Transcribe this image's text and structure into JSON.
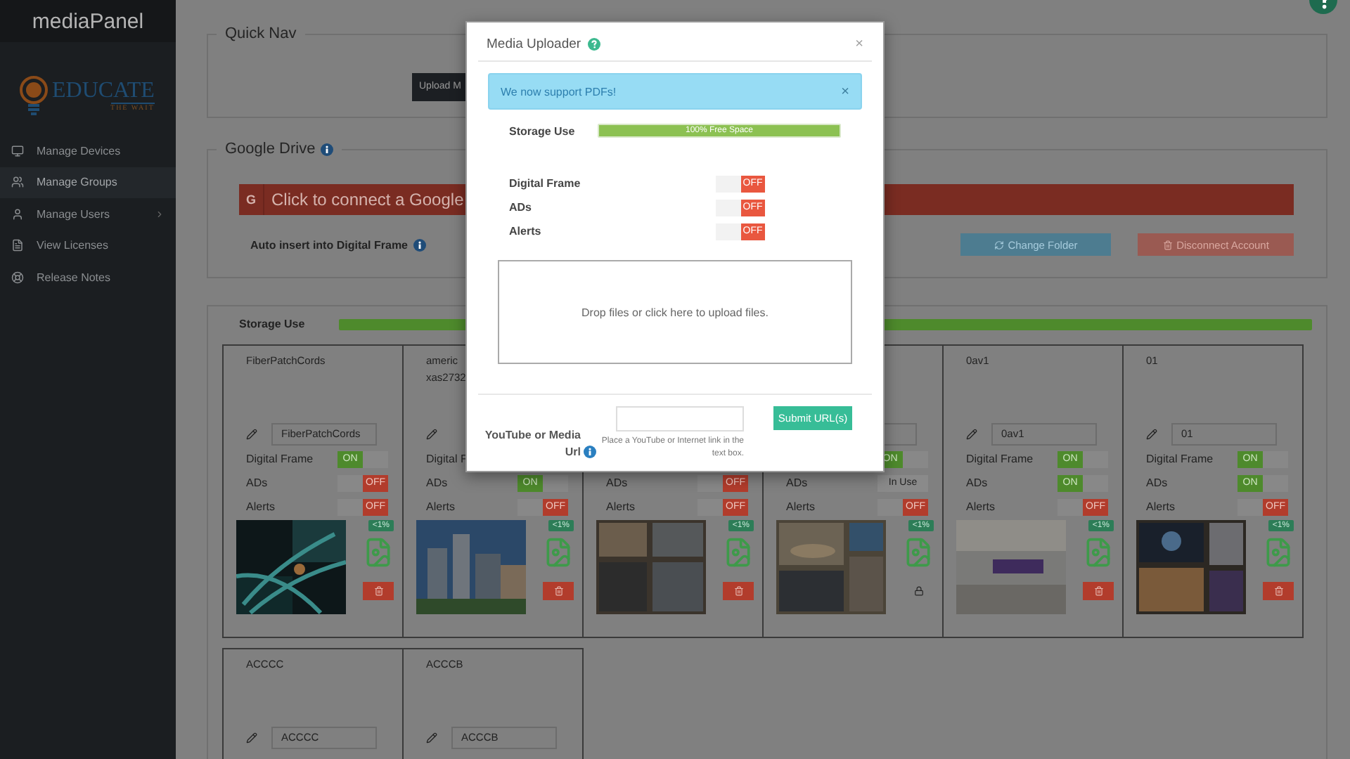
{
  "sidebar": {
    "brand": "mediaPanel",
    "logo": {
      "word": "EDUCATE",
      "tagline": "THE WAIT"
    },
    "items": [
      {
        "label": "Manage Devices",
        "selected": false,
        "submenu": false
      },
      {
        "label": "Manage Groups",
        "selected": true,
        "submenu": false
      },
      {
        "label": "Manage Users",
        "selected": false,
        "submenu": true
      },
      {
        "label": "View Licenses",
        "selected": false,
        "submenu": false
      },
      {
        "label": "Release Notes",
        "selected": false,
        "submenu": false
      }
    ]
  },
  "quick_nav": {
    "title": "Quick Nav",
    "buttons": [
      "Upload M"
    ]
  },
  "google_drive": {
    "title": "Google Drive",
    "glyph": "G",
    "connect": "Click to connect a Google",
    "auto_insert": "Auto insert into Digital Frame",
    "buttons": [
      {
        "label": "Change Folder",
        "kind": "refresh"
      },
      {
        "label": "Disconnect Account",
        "kind": "danger"
      }
    ]
  },
  "storage": {
    "label": "Storage Use",
    "level": 1
  },
  "media_cards": [
    {
      "title": [
        "FiberPatchCords"
      ],
      "edit": {
        "pencil": true,
        "value": "FiberPatchCords"
      },
      "settings": [
        {
          "label": "Digital Frame",
          "toggle": {
            "kind": "switch",
            "on": true,
            "text": "ON"
          }
        },
        {
          "label": "ADs",
          "toggle": {
            "kind": "switch",
            "on": false,
            "text": "OFF"
          }
        },
        {
          "label": "Alerts",
          "toggle": {
            "kind": "switch",
            "on": false,
            "text": "OFF"
          }
        }
      ],
      "usage": "<1%",
      "locked": false
    },
    {
      "title": [
        "americ",
        "xas2732"
      ],
      "edit": {
        "pencil": true
      },
      "settings": [
        {
          "label": "Digital F"
        },
        {
          "label": "ADs",
          "toggle": {
            "kind": "switch",
            "on": true,
            "text": "ON"
          }
        },
        {
          "label": "Alerts",
          "toggle": {
            "kind": "switch",
            "on": false,
            "text": "OFF"
          }
        }
      ],
      "usage": "<1%",
      "locked": false
    },
    {
      "settings": [
        {
          "label": "ADs",
          "toggle": {
            "kind": "switch",
            "on": false,
            "text": "OFF"
          }
        },
        {
          "label": "Alerts",
          "toggle": {
            "kind": "switch",
            "on": false,
            "text": "OFF"
          }
        }
      ],
      "usage": "<1%",
      "locked": false
    },
    {
      "edit": {
        "pencil": false
      },
      "settings": [
        {
          "toggle": {
            "kind": "switch",
            "on": true,
            "text": "ON"
          }
        },
        {
          "label": "ADs",
          "toggle": {
            "kind": "status",
            "text": "In Use"
          }
        },
        {
          "label": "Alerts",
          "toggle": {
            "kind": "switch",
            "on": false,
            "text": "OFF"
          }
        }
      ],
      "usage": "<1%",
      "locked": true
    },
    {
      "title": [
        "0av1"
      ],
      "edit": {
        "pencil": true,
        "value": "0av1"
      },
      "settings": [
        {
          "label": "Digital Frame",
          "toggle": {
            "kind": "switch",
            "on": true,
            "text": "ON"
          }
        },
        {
          "label": "ADs",
          "toggle": {
            "kind": "switch",
            "on": true,
            "text": "ON"
          }
        },
        {
          "label": "Alerts",
          "toggle": {
            "kind": "switch",
            "on": false,
            "text": "OFF"
          }
        }
      ],
      "usage": "<1%",
      "locked": false
    },
    {
      "title": [
        "01"
      ],
      "edit": {
        "pencil": true,
        "value": "01"
      },
      "settings": [
        {
          "label": "Digital Frame",
          "toggle": {
            "kind": "switch",
            "on": true,
            "text": "ON"
          }
        },
        {
          "label": "ADs",
          "toggle": {
            "kind": "switch",
            "on": true,
            "text": "ON"
          }
        },
        {
          "label": "Alerts",
          "toggle": {
            "kind": "switch",
            "on": false,
            "text": "OFF"
          }
        }
      ],
      "usage": "<1%",
      "locked": false
    },
    {
      "title": [
        "ACCCC"
      ],
      "edit": {
        "pencil": true,
        "value": "ACCCC"
      }
    },
    {
      "title": [
        "ACCCB"
      ],
      "edit": {
        "pencil": true,
        "value": "ACCCB"
      }
    }
  ],
  "modal": {
    "title": "Media Uploader",
    "close": "×",
    "alert": {
      "text": "We now support PDFs!",
      "close": "×"
    },
    "storage": {
      "label": "Storage Use",
      "level": 1,
      "reading": "100% Free Space"
    },
    "settings": [
      {
        "label": "Digital Frame",
        "toggle": {
          "kind": "switch",
          "on": false,
          "text": "OFF"
        }
      },
      {
        "label": "ADs",
        "toggle": {
          "kind": "switch",
          "on": false,
          "text": "OFF"
        }
      },
      {
        "label": "Alerts",
        "toggle": {
          "kind": "switch",
          "on": false,
          "text": "OFF"
        }
      }
    ],
    "drop_zone": "Drop files or click here to upload files.",
    "url": {
      "label": "YouTube or Media Url",
      "hint": "Place a YouTube or Internet link in the text box.",
      "submit": "Submit URL(s)"
    }
  }
}
